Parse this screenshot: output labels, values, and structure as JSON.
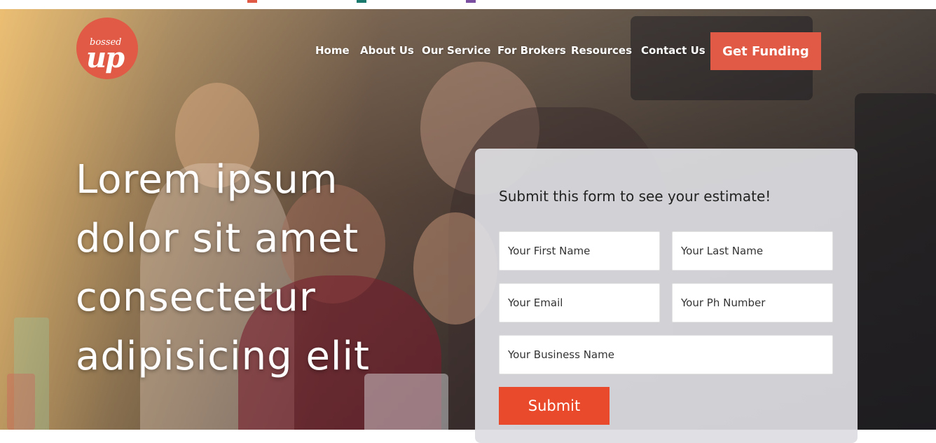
{
  "top_strip": {
    "marker_colors": [
      "#e05a45",
      "#1a7a6e",
      "#7a4ea0"
    ]
  },
  "logo": {
    "text_small": "bossed",
    "text_large": "up",
    "color": "#e05a45"
  },
  "nav": {
    "items": [
      {
        "label": "Home"
      },
      {
        "label": "About Us"
      },
      {
        "label": "Our Service"
      },
      {
        "label": "For Brokers"
      },
      {
        "label": "Resources"
      },
      {
        "label": "Contact Us"
      }
    ],
    "cta_label": "Get Funding"
  },
  "hero": {
    "headline_lines": [
      "Lorem ipsum",
      "dolor sit amet",
      "consectetur",
      "adipisicing elit"
    ]
  },
  "form": {
    "title": "Submit this form to see your estimate!",
    "fields": {
      "first_name": {
        "placeholder": "Your First Name",
        "value": ""
      },
      "last_name": {
        "placeholder": "Your Last Name",
        "value": ""
      },
      "email": {
        "placeholder": "Your Email",
        "value": ""
      },
      "phone": {
        "placeholder": "Your Ph Number",
        "value": ""
      },
      "business": {
        "placeholder": "Your Business Name",
        "value": ""
      }
    },
    "submit_label": "Submit"
  },
  "colors": {
    "accent": "#e05a45",
    "submit": "#ea4a2c",
    "form_background": "#dedee2"
  }
}
